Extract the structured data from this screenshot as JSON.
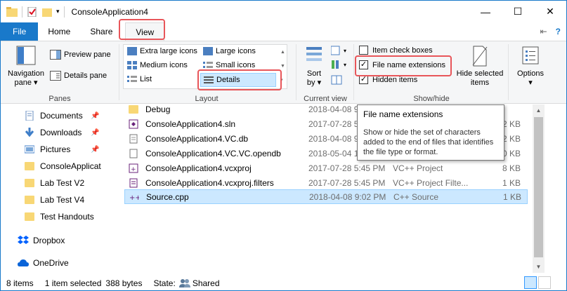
{
  "window": {
    "title": "ConsoleApplication4",
    "controls": {
      "minimize": "—",
      "maximize": "☐",
      "close": "✕"
    }
  },
  "tabs": {
    "file": "File",
    "home": "Home",
    "share": "Share",
    "view": "View"
  },
  "ribbon": {
    "panes": {
      "label": "Panes",
      "navigation_pane": "Navigation",
      "navigation_pane_2": "pane ▾",
      "preview_pane": "Preview pane",
      "details_pane": "Details pane"
    },
    "layout": {
      "label": "Layout",
      "extra_large_icons": "Extra large icons",
      "large_icons": "Large icons",
      "medium_icons": "Medium icons",
      "small_icons": "Small icons",
      "list": "List",
      "details": "Details"
    },
    "current_view": {
      "label": "Current view",
      "sort_by": "Sort",
      "sort_by_2": "by ▾"
    },
    "show_hide": {
      "label": "Show/hide",
      "item_check_boxes": "Item check boxes",
      "file_name_extensions": "File name extensions",
      "hidden_items": "Hidden items",
      "hide_selected": "Hide selected",
      "hide_selected_2": "items"
    },
    "options": {
      "label": "Options",
      "arrow": "▾"
    }
  },
  "nav": {
    "items": [
      {
        "label": "Documents",
        "pinned": "📌"
      },
      {
        "label": "Downloads",
        "pinned": "📌"
      },
      {
        "label": "Pictures",
        "pinned": "📌"
      },
      {
        "label": "ConsoleApplicat"
      },
      {
        "label": "Lab Test V2"
      },
      {
        "label": "Lab Test V4"
      },
      {
        "label": "Test Handouts"
      },
      {
        "label": "Dropbox"
      },
      {
        "label": "OneDrive"
      }
    ]
  },
  "files": [
    {
      "name": "Debug",
      "date": "2018-04-08 9",
      "type": "",
      "size": ""
    },
    {
      "name": "ConsoleApplication4.sln",
      "date": "2017-07-28 5",
      "type": "",
      "size": "2 KB"
    },
    {
      "name": "ConsoleApplication4.VC.db",
      "date": "2018-04-08 9",
      "type": "",
      "size": "2 KB"
    },
    {
      "name": "ConsoleApplication4.VC.VC.opendb",
      "date": "2018-05-04 1",
      "type": "",
      "size": "0 KB"
    },
    {
      "name": "ConsoleApplication4.vcxproj",
      "date": "2017-07-28 5:45 PM",
      "type": "VC++ Project",
      "size": "8 KB"
    },
    {
      "name": "ConsoleApplication4.vcxproj.filters",
      "date": "2017-07-28 5:45 PM",
      "type": "VC++ Project Filte...",
      "size": "1 KB"
    },
    {
      "name": "Source.cpp",
      "date": "2018-04-08 9:02 PM",
      "type": "C++ Source",
      "size": "1 KB"
    }
  ],
  "tooltip": {
    "title": "File name extensions",
    "body": "Show or hide the set of characters added to the end of files that identifies the file type or format."
  },
  "status": {
    "count": "8 items",
    "selected": "1 item selected",
    "size": "388 bytes",
    "state_label": "State:",
    "state_value": "Shared"
  },
  "colors": {
    "accent": "#1979ca",
    "highlight": "#e8565a",
    "selection": "#cce8ff"
  }
}
